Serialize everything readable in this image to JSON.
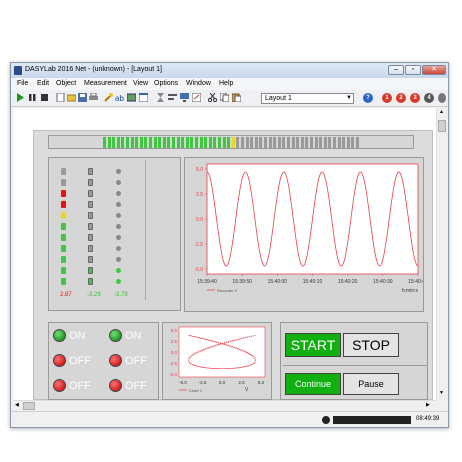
{
  "window": {
    "title": "DASYLab 2016 Net - (unknown) - [Layout 1]"
  },
  "menu": [
    "File",
    "Edit",
    "Object",
    "Measurement",
    "View",
    "Options",
    "Window",
    "Help"
  ],
  "toolbar": {
    "layout_value": "Layout 1",
    "circle_labels": [
      "1",
      "2",
      "3",
      "4"
    ]
  },
  "meters": {
    "values": [
      "2.87",
      "-3.29",
      "-3.79"
    ]
  },
  "lamps": [
    {
      "label": "ON",
      "state": "on"
    },
    {
      "label": "OFF",
      "state": "off"
    },
    {
      "label": "OFF",
      "state": "off"
    },
    {
      "label": "ON",
      "state": "on"
    },
    {
      "label": "OFF",
      "state": "off"
    },
    {
      "label": "OFF",
      "state": "off"
    }
  ],
  "buttons": {
    "start": "START",
    "stop": "STOP",
    "continue": "Continue",
    "pause": "Pause"
  },
  "status": {
    "time": "08:49:39"
  },
  "colors": {
    "accent": "#00a000",
    "alarm": "#ff0000",
    "trace": "#e8404a"
  },
  "chart_data": [
    {
      "type": "line",
      "title": "",
      "xlabel": "h:min:s",
      "ylabel": "",
      "ylim": [
        -5,
        5
      ],
      "y_ticks": [
        "5.0",
        "2.5",
        "0.0",
        "-2.5",
        "-5.0"
      ],
      "x_ticks": [
        "15:39:40",
        "15:39:50",
        "15:40:00",
        "15:40:10",
        "15:40:20",
        "15:40:30",
        "15:40:40"
      ],
      "series": [
        {
          "name": "Recorder 0",
          "shape": "sine",
          "cycles": 5.5
        }
      ]
    },
    {
      "type": "line",
      "title": "",
      "xlabel": "V",
      "ylabel": "",
      "xlim": [
        -5,
        5
      ],
      "ylim": [
        -5,
        5
      ],
      "y_ticks": [
        "5.0",
        "2.5",
        "0.0",
        "-2.5",
        "-5.0"
      ],
      "x_ticks": [
        "-5.0",
        "-2.5",
        "0.0",
        "2.5",
        "5.0"
      ],
      "series": [
        {
          "name": "Chart 1",
          "shape": "lissajous"
        }
      ]
    }
  ]
}
